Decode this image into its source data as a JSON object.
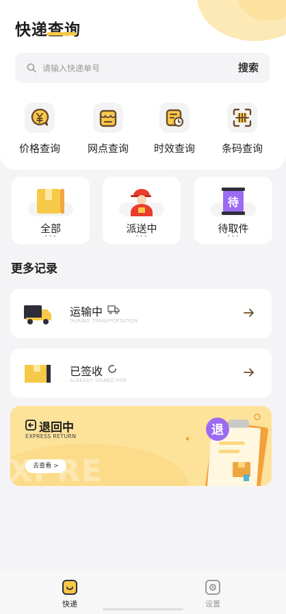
{
  "header": {
    "title": "快递查询"
  },
  "search": {
    "placeholder": "请输入快递单号",
    "button_label": "搜索"
  },
  "quick_actions": [
    {
      "label": "价格查询",
      "icon": "price-icon"
    },
    {
      "label": "网点查询",
      "icon": "outlet-icon"
    },
    {
      "label": "时效查询",
      "icon": "timeliness-icon"
    },
    {
      "label": "条码查询",
      "icon": "barcode-icon"
    }
  ],
  "status_cards": [
    {
      "label": "全部",
      "dots": "•••"
    },
    {
      "label": "派送中",
      "dots": "•••"
    },
    {
      "label": "待取件",
      "dots": "•••",
      "badge": "待"
    }
  ],
  "records": {
    "section_title": "更多记录",
    "items": [
      {
        "title": "运输中",
        "subtitle": "DURING TRANSPORTATION"
      },
      {
        "title": "已签收",
        "subtitle": "ALREADY SIGNED FOR"
      }
    ]
  },
  "return_banner": {
    "title": "退回中",
    "subtitle": "EXPRESS RETURN",
    "button_label": "去查看 >",
    "badge": "退",
    "watermark": "XPRE"
  },
  "tabbar": {
    "items": [
      {
        "label": "快递",
        "active": true
      },
      {
        "label": "设置",
        "active": false
      }
    ]
  },
  "colors": {
    "accent": "#f7c948",
    "brown": "#6b4a2b",
    "banner": "#fde29a",
    "purple": "#9b6bf2"
  }
}
